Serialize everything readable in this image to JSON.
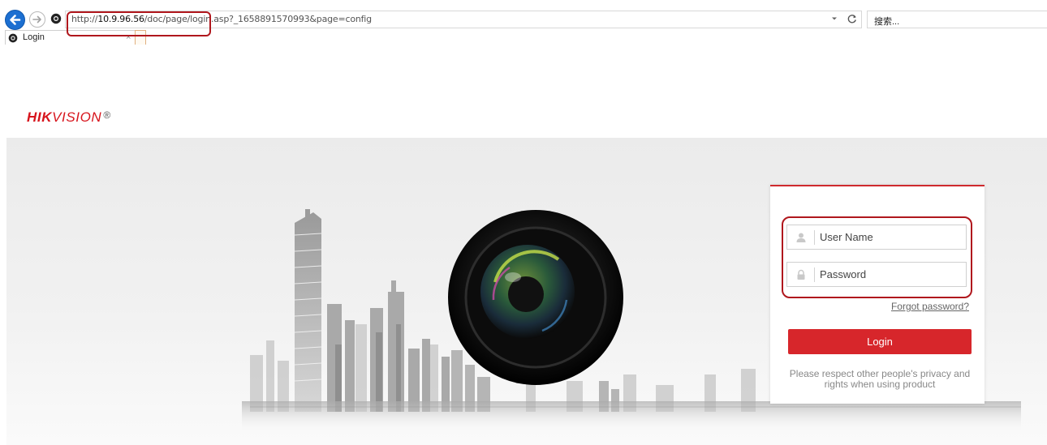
{
  "browser": {
    "address_scheme": "http://",
    "address_host": "10.9.96.56",
    "address_rest": "/doc/page/login.asp?_1658891570993&page=config",
    "search_placeholder": "搜索...",
    "tab_title": "Login",
    "tab_close": "×"
  },
  "brand": {
    "logo_bold": "HIK",
    "logo_light": "VISION",
    "logo_mark": "®",
    "brand_color": "#d7141c"
  },
  "login": {
    "username_placeholder": "User Name",
    "password_placeholder": "Password",
    "forgot_password": "Forgot password?",
    "login_button": "Login",
    "privacy_notice": "Please respect other people's privacy and rights when using product",
    "button_color": "#d7262b"
  },
  "icons": {
    "back": "arrow-left-icon",
    "forward": "arrow-right-icon",
    "site": "site-favicon-icon",
    "dropdown": "chevron-down-icon",
    "refresh": "refresh-icon",
    "user": "user-icon",
    "lock": "lock-icon"
  }
}
